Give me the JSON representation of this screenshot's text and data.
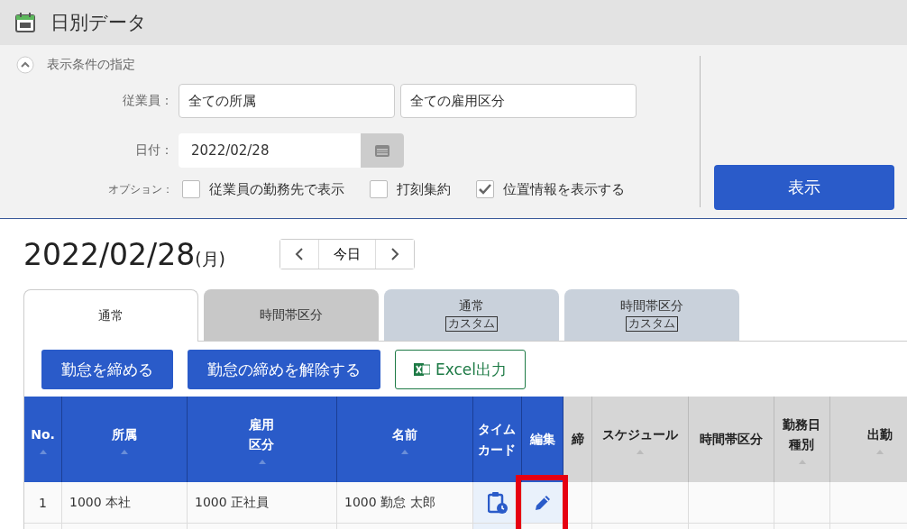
{
  "header": {
    "title": "日別データ"
  },
  "filter": {
    "toggle_label": "表示条件の指定",
    "expanded": true,
    "employee": {
      "label": "従業員：",
      "department": "全ての所属",
      "employment_type": "全ての雇用区分"
    },
    "date": {
      "label": "日付：",
      "value": "2022/02/28"
    },
    "options_label": "オプション：",
    "options": [
      {
        "label": "従業員の勤務先で表示",
        "checked": false
      },
      {
        "label": "打刻集約",
        "checked": false
      },
      {
        "label": "位置情報を表示する",
        "checked": true
      }
    ],
    "submit": "表示"
  },
  "day": {
    "date": "2022/02/28",
    "weekday": "(月)",
    "today": "今日"
  },
  "tabs": [
    {
      "label": "通常",
      "selected": true
    },
    {
      "label": "時間帯区分",
      "selected": false
    },
    {
      "label": "通常",
      "badge": "カスタム",
      "selected": false
    },
    {
      "label": "時間帯区分",
      "badge": "カスタム",
      "selected": false
    }
  ],
  "actions": [
    {
      "label": "勤怠を締める",
      "kind": "primary"
    },
    {
      "label": "勤怠の締めを解除する",
      "kind": "primary"
    },
    {
      "label": "Excel出力",
      "kind": "excel"
    }
  ],
  "table": {
    "columns": [
      {
        "label": "No.",
        "kind": "primary"
      },
      {
        "label": "所属",
        "kind": "primary"
      },
      {
        "label": "雇用区分",
        "kind": "primary"
      },
      {
        "label": "名前",
        "kind": "primary"
      },
      {
        "label": "タイムカード",
        "kind": "primary",
        "sortable": false
      },
      {
        "label": "編集",
        "kind": "primary",
        "sortable": false
      },
      {
        "label": "締",
        "kind": "secondary",
        "sortable": false
      },
      {
        "label": "スケジュール",
        "kind": "secondary"
      },
      {
        "label": "時間帯区分",
        "kind": "secondary",
        "sortable": false
      },
      {
        "label": "勤務日種別",
        "kind": "secondary"
      },
      {
        "label": "出勤",
        "kind": "secondary"
      }
    ],
    "rows": [
      {
        "cells": [
          "1",
          "1000 本社",
          "1000 正社員",
          "1000 勤怠 太郎",
          "",
          "",
          "",
          "",
          "",
          "",
          ""
        ],
        "edit_highlighted": true
      }
    ]
  }
}
